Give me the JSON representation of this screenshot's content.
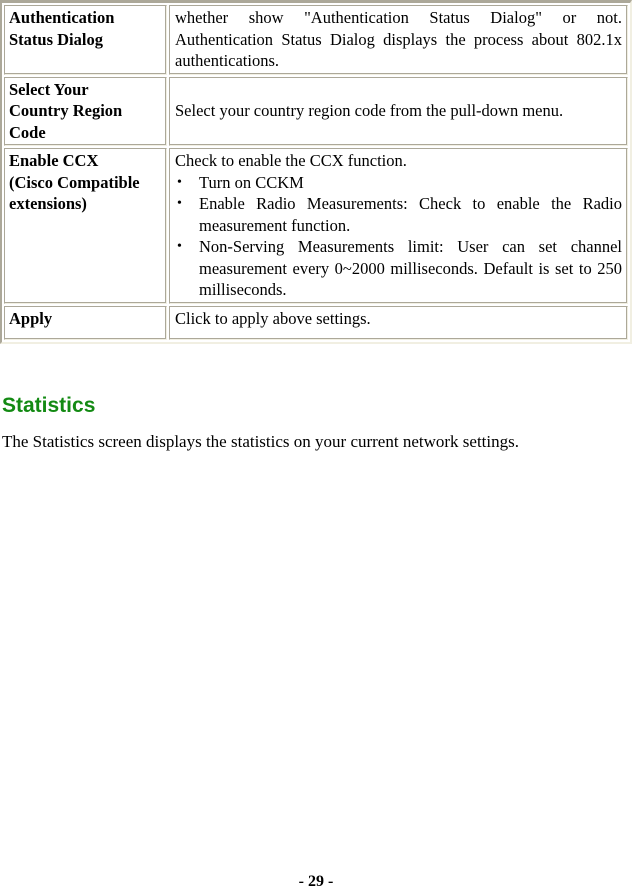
{
  "table": {
    "rows": [
      {
        "name": "Authentication Status Dialog",
        "name_lines": [
          "Authentication",
          "Status Dialog"
        ],
        "description": "whether show \"Authentication Status Dialog\" or not. Authentication Status Dialog displays the process about 802.1x authentications."
      },
      {
        "name": "Select Your Country Region Code",
        "name_lines": [
          "Select Your",
          "Country Region",
          "Code"
        ],
        "description": "Select your country region code from the pull-down menu."
      },
      {
        "name": "Enable CCX (Cisco Compatible extensions)",
        "name_lines": [
          "Enable CCX",
          "(Cisco Compatible",
          "extensions)"
        ],
        "description": "Check to enable the CCX function.",
        "bullets": [
          "Turn on CCKM",
          "Enable Radio Measurements: Check to enable the Radio measurement function.",
          "Non-Serving Measurements limit: User can set channel measurement every 0~2000 milliseconds. Default is set to 250 milliseconds."
        ]
      },
      {
        "name": "Apply",
        "name_lines": [
          "Apply"
        ],
        "description": "Click to apply above settings."
      }
    ]
  },
  "bullet_glyph": "•",
  "section": {
    "title": "Statistics",
    "title_color": "#138a13",
    "body": "The Statistics screen displays the statistics on your current network settings."
  },
  "page_number": "- 29 -"
}
